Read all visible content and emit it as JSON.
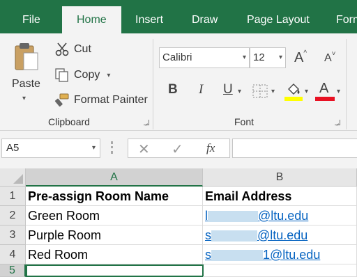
{
  "tabs": [
    "File",
    "Home",
    "Insert",
    "Draw",
    "Page Layout",
    "Form"
  ],
  "active_tab": "Home",
  "clipboard": {
    "paste": "Paste",
    "cut": "Cut",
    "copy": "Copy",
    "format_painter": "Format Painter",
    "group_label": "Clipboard"
  },
  "font": {
    "name": "Calibri",
    "size": "12",
    "bold": "B",
    "italic": "I",
    "underline": "U",
    "increase_glyph": "A",
    "decrease_glyph": "A",
    "font_color_glyph": "A",
    "group_label": "Font",
    "highlight_color": "#ffff00",
    "font_color": "#e81123"
  },
  "formula_bar": {
    "name_box": "A5",
    "fx": "fx",
    "formula": ""
  },
  "sheet": {
    "columns": [
      "A",
      "B"
    ],
    "rows": [
      {
        "num": "1",
        "a": "Pre-assign Room Name",
        "b": "Email Address"
      },
      {
        "num": "2",
        "a": "Green Room",
        "b": "@ltu.edu",
        "b_prefix": "l"
      },
      {
        "num": "3",
        "a": "Purple Room",
        "b": "@ltu.edu",
        "b_prefix": "s"
      },
      {
        "num": "4",
        "a": "Red Room",
        "b": "1@ltu.edu",
        "b_prefix": "s"
      },
      {
        "num": "5",
        "a": "",
        "b": ""
      }
    ],
    "selected_cell": "A5"
  },
  "colors": {
    "accent": "#217346",
    "link": "#0563c1"
  }
}
